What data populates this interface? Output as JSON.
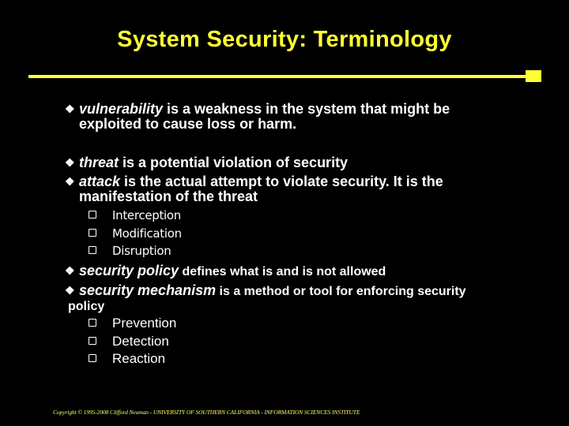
{
  "slide": {
    "title": "System Security: Terminology",
    "accent_color": "#ffff33",
    "bullet_icon": "diamond-cluster-icon",
    "items": [
      {
        "term": "vulnerability",
        "line1": " is a weakness in the system that might be",
        "line2": "exploited to cause loss or harm."
      },
      {
        "term": "threat",
        "line1": " is a potential violation of security"
      },
      {
        "term": "attack",
        "line1": " is the actual attempt to violate security.  It is the",
        "line2": "manifestation of the threat",
        "subitems": [
          "Interception",
          "Modification",
          "Disruption"
        ]
      },
      {
        "term": "security policy",
        "line1": " defines what is and is not allowed"
      },
      {
        "term": "security mechanism",
        "line1": " is a method or tool for enforcing security",
        "line2": "policy",
        "subitems": [
          "Prevention",
          "Detection",
          "Reaction"
        ]
      }
    ],
    "footer": "Copyright © 1995-2008 Clifford Neuman  -  UNIVERSITY OF SOUTHERN CALIFORNIA  -  INFORMATION SCIENCES INSTITUTE"
  }
}
